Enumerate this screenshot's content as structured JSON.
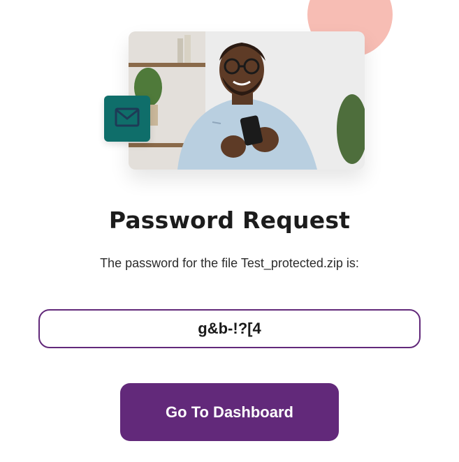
{
  "hero": {
    "photo_alt": "person-smiling-at-phone",
    "badge_icon": "mail-icon",
    "accent_color": "#f7bdb4",
    "badge_color": "#0f6e6a"
  },
  "main": {
    "title": "Password Request",
    "message": "The password for the file Test_protected.zip is:",
    "password": "g&b-!?[4",
    "button_label": "Go To Dashboard",
    "brand_color": "#62297a"
  }
}
